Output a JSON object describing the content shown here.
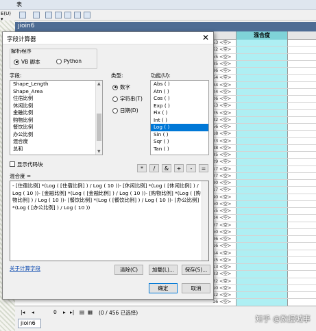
{
  "background": {
    "window_title": "表",
    "left_menu": "E(U) ▾",
    "table_name": "jioin6",
    "column_header": "混合度",
    "row_numbers": [
      "53",
      "52",
      "55",
      "85",
      "86",
      "54",
      "84",
      "24",
      "26",
      "53",
      "25",
      "42",
      "56",
      "18",
      "23",
      "48",
      "45",
      "29",
      "17",
      "27",
      "30",
      "17",
      "40",
      "50",
      "55",
      "24",
      "37",
      "50",
      "36",
      "16",
      "14",
      "15",
      "13",
      "33",
      "32",
      "10",
      "12",
      "16"
    ],
    "row_value": "<空>",
    "nav_page": "0",
    "status_text": "(0 / 456 已选择)",
    "tab_label": "jioin6",
    "watermark": "知乎 @数据城事"
  },
  "dialog": {
    "title": "字段计算器",
    "close_glyph": "✕",
    "parser_label": "解析程序",
    "parser_options": [
      "VB 脚本",
      "Python"
    ],
    "parser_selected": "VB 脚本",
    "fields_label": "字段:",
    "fields": [
      "Shape_Length",
      "Shape_Area",
      "住宿比例",
      "休闲比例",
      "金融比例",
      "购物比例",
      "餐饮比例",
      "办公比例",
      "混合度",
      "总和"
    ],
    "type_label": "类型:",
    "types": [
      "数字",
      "字符串(T)",
      "日期(D)"
    ],
    "type_selected": "数字",
    "functions_label": "功能(U):",
    "functions": [
      "Abs ( )",
      "Atn ( )",
      "Cos ( )",
      "Exp ( )",
      "Fix ( )",
      "Int ( )",
      "Log ( )",
      "Sin ( )",
      "Sqr ( )",
      "Tan ( )"
    ],
    "function_selected": "Log ( )",
    "show_codeblock_label": "显示代码块",
    "operators": [
      "*",
      "/",
      "&",
      "+",
      "-",
      "="
    ],
    "expression_label": "混合度 =",
    "expression": "- [住宿比例] *(Log ( [住宿比例] ) / Log ( 10 ))- [休闲比例] *(Log ( [休闲比例] ) / Log ( 10 ))- [金融比例] *(Log ( [金融比例] ) / Log ( 10 ))- [购物比例] *(Log ( [购物比例] ) / Log ( 10 ))- [餐饮比例] *(Log ( [餐饮比例] ) / Log ( 10 ))- [办公比例] *(Log ( [办公比例] ) / Log ( 10 ))",
    "about_link": "关于计算字段",
    "clear_button": "清除(C)",
    "load_button": "加载(L)...",
    "save_button": "保存(S)...",
    "ok_button": "确定",
    "cancel_button": "取消"
  }
}
